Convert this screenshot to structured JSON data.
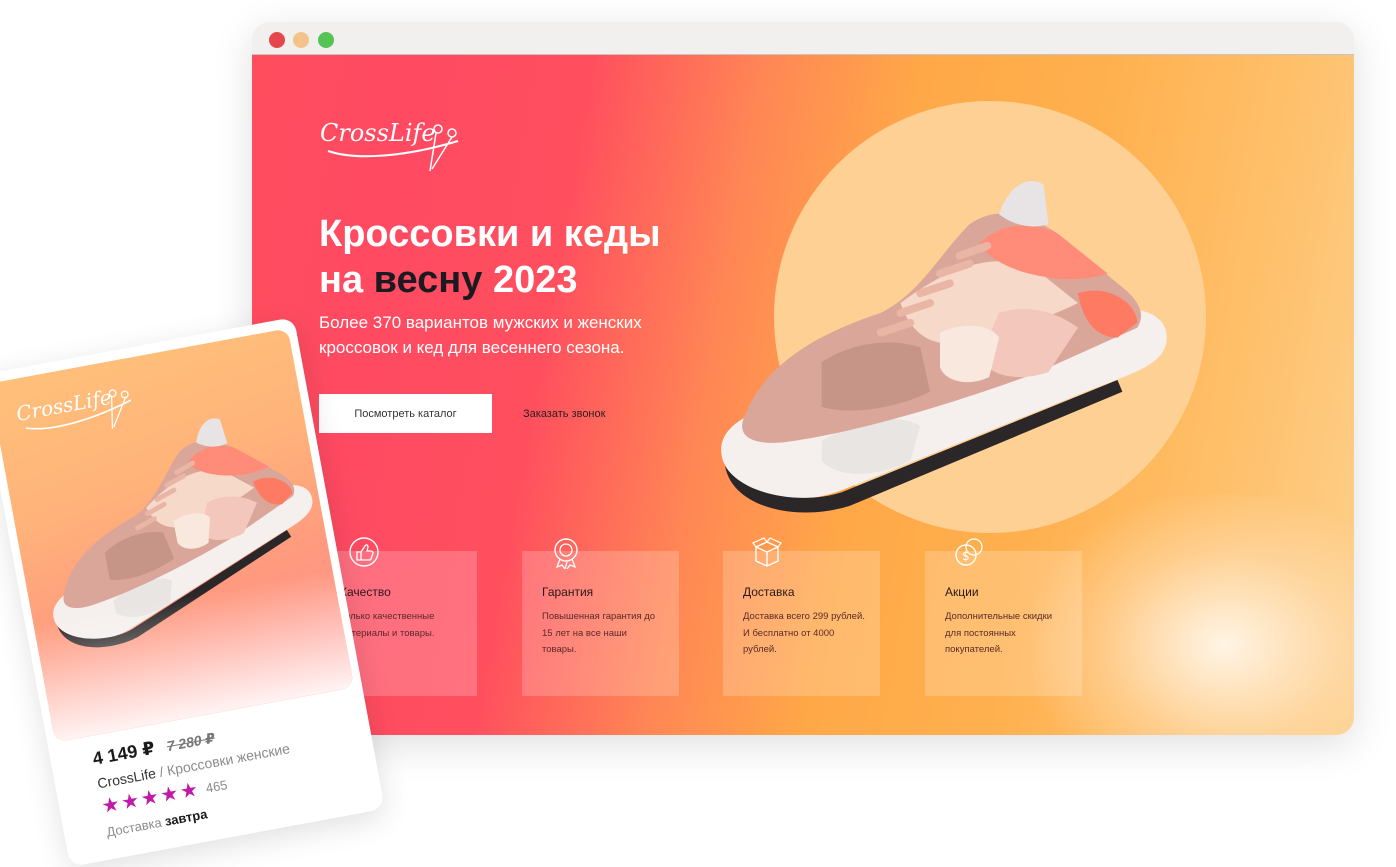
{
  "window": {
    "traffic_lights": [
      "close",
      "minimize",
      "maximize"
    ]
  },
  "hero": {
    "logo_text": "CrossLife",
    "title_line1": "Кроссовки и кеды",
    "title_line2_prefix": "на",
    "title_line2_highlight": "весну",
    "title_line2_suffix": "2023",
    "subtitle": "Более 370 вариантов мужских и женских кроссовок и кед для весеннего сезона.",
    "catalog_button": "Посмотреть каталог",
    "call_button": "Заказать звонок"
  },
  "features": [
    {
      "icon": "thumbs-up-icon",
      "title": "Качество",
      "text": "Только качественные материалы и товары."
    },
    {
      "icon": "medal-icon",
      "title": "Гарантия",
      "text": "Повышенная гарантия до 15 лет на все наши товары."
    },
    {
      "icon": "box-icon",
      "title": "Доставка",
      "text": "Доставка всего 299 рублей. И бесплатно от 4000 рублей."
    },
    {
      "icon": "coins-icon",
      "title": "Акции",
      "text": "Дополнительные скидки для постоянных покупателей."
    }
  ],
  "card": {
    "logo_text": "CrossLife",
    "price": "4 149 ₽",
    "old_price": "7 280 ₽",
    "brand": "CrossLife",
    "separator": " / ",
    "category": "Кроссовки женские",
    "rating_stars": 5,
    "reviews": "465",
    "delivery_label": "Доставка",
    "delivery_value": "завтра"
  },
  "colors": {
    "accent_red": "#ff4d5e",
    "accent_orange": "#ffb04e",
    "star": "#c21aa8"
  }
}
